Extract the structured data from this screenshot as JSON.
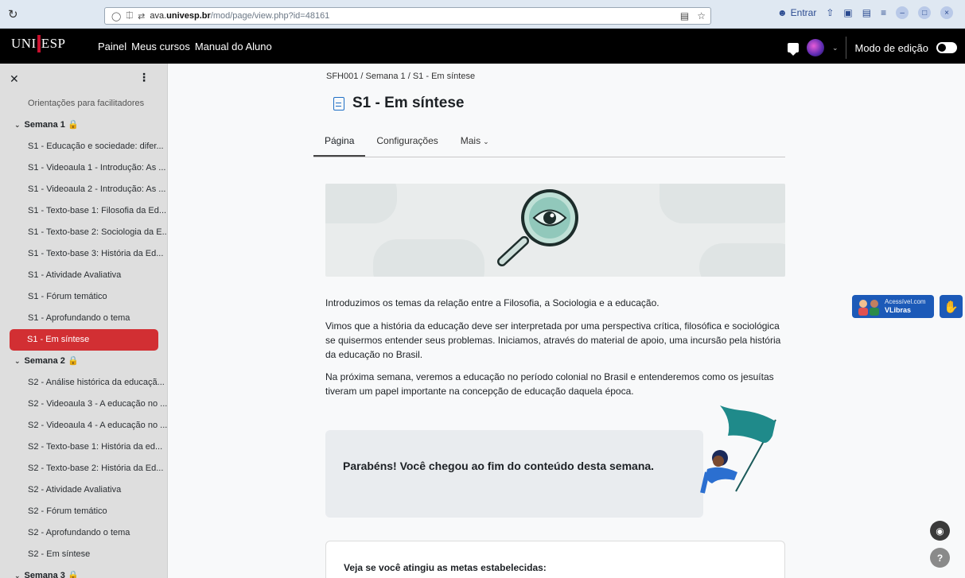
{
  "browser": {
    "reload_icon": "reload-icon",
    "url_host_pre": "ava.",
    "url_host_main": "univesp.br",
    "url_path": "/mod/page/view.php?id=48161",
    "signin_label": "Entrar"
  },
  "navbar": {
    "logo_left": "UNI",
    "logo_right": "ESP",
    "links": [
      "Painel",
      "Meus cursos",
      "Manual do Aluno"
    ],
    "edit_mode_label": "Modo de edição"
  },
  "drawer": {
    "top_item": "Orientações para facilitadores",
    "sections": [
      {
        "title": "Semana 1",
        "items": [
          "S1 - Educação e sociedade: difer...",
          "S1 - Videoaula 1 - Introdução: As ...",
          "S1 - Videoaula 2 - Introdução: As ...",
          "S1 - Texto-base 1: Filosofia da Ed...",
          "S1 - Texto-base 2: Sociologia da E...",
          "S1 - Texto-base 3: História da Ed...",
          "S1 - Atividade Avaliativa",
          "S1 - Fórum temático",
          "S1 - Aprofundando o tema",
          "S1 - Em síntese"
        ]
      },
      {
        "title": "Semana 2",
        "items": [
          "S2 - Análise histórica da educaçã...",
          "S2 - Videoaula 3 - A educação no ...",
          "S2 - Videoaula 4 - A educação no ...",
          "S2 - Texto-base 1: História da ed...",
          "S2 - Texto-base 2: História da Ed...",
          "S2 - Atividade Avaliativa",
          "S2 - Fórum temático",
          "S2 - Aprofundando o tema",
          "S2 - Em síntese"
        ]
      },
      {
        "title": "Semana 3",
        "items": []
      }
    ]
  },
  "main": {
    "breadcrumb": "SFH001 / Semana 1 / S1 - Em síntese",
    "title": "S1 - Em síntese",
    "tabs": [
      "Página",
      "Configurações",
      "Mais"
    ],
    "paragraphs": [
      "Introduzimos os temas da relação entre a Filosofia, a Sociologia e a educação.",
      "Vimos que a história da educação deve ser interpretada por uma perspectiva crítica, filosófica e sociológica se quisermos entender seus problemas. Iniciamos, através do material de apoio, uma incursão pela história da educação no Brasil.",
      "Na próxima semana, veremos a educação no período colonial no Brasil e entenderemos como os jesuítas tiveram um papel importante na concepção de educação daquela época."
    ],
    "congrats": "Parabéns! Você chegou ao fim do conteúdo desta semana.",
    "goals": "Veja se você atingiu as metas estabelecidas:"
  },
  "widgets": {
    "vlibras_line1": "Acessível.com",
    "vlibras_line2": "VLibras",
    "help_label": "?"
  },
  "colors": {
    "active_item": "#d22f33",
    "accent_blue": "#1f6fc5",
    "vlibras_blue": "#1c5ab8"
  }
}
